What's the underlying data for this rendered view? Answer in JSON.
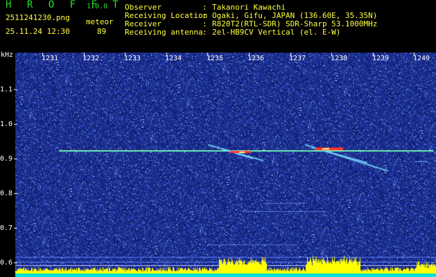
{
  "app": {
    "name": "H R O F F T",
    "version": "1.0.0"
  },
  "image": {
    "filename": "2511241230.png",
    "datetime": "25.11.24 12:30"
  },
  "meteor": {
    "label": "meteor",
    "count": "89"
  },
  "info": [
    {
      "label": "Observer",
      "value": "Takanori Kawachi"
    },
    {
      "label": "Receiving Location",
      "value": "Ogaki, Gifu, JAPAN (136.60E, 35.35N)"
    },
    {
      "label": "Receiver",
      "value": "R820T2(RTL-SDR) SDR-Sharp 53.1000MHz"
    },
    {
      "label": "Receiving antenna",
      "value": "2el-HB9CV Vertical (el. E-W)"
    }
  ],
  "axis": {
    "unit": "kHz",
    "y_ticks": [
      "1.1",
      "1.0",
      "0.9",
      "0.8",
      "0.7",
      "0.6"
    ],
    "x_ticks": [
      "1231",
      "1232",
      "1233",
      "1234",
      "1235",
      "1236",
      "1237",
      "1238",
      "1239",
      "1240"
    ]
  },
  "colors": {
    "background": "#000000",
    "spectrogram_bg": "#1a2a8a",
    "text_green": "#28e028",
    "text_white": "#ffffff",
    "text_yellow": "#ffff40",
    "signal_line": "#40e0c0",
    "meteor_echo": "#ff3030",
    "level_bar": "#ffff00",
    "baseline": "#00e0e0"
  }
}
